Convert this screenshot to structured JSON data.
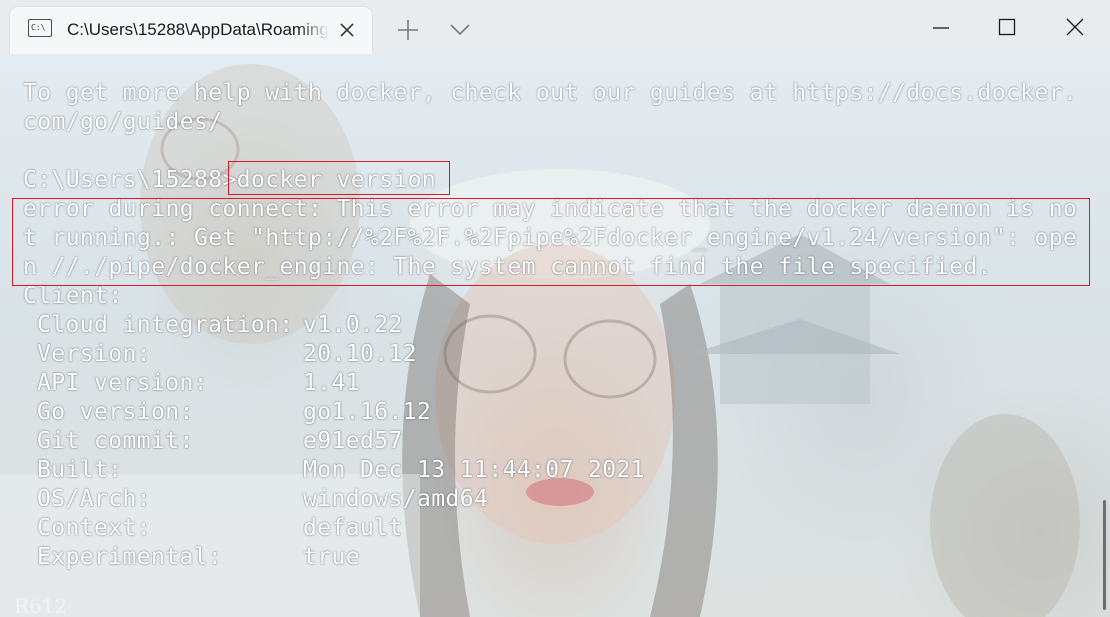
{
  "window": {
    "tab_title": "C:\\Users\\15288\\AppData\\Roaming",
    "tab_icon_glyph": "C:\\",
    "controls": [
      "minimize-icon",
      "maximize-icon",
      "close-icon"
    ],
    "colors": {
      "titlebar": "#e9ecee",
      "tab": "#f6f7f8",
      "highlight": "#d81b2a",
      "terminal_text": "#ffffff"
    }
  },
  "terminal": {
    "help_line_1": "To get more help with docker, check out our guides at https://docs.docker.",
    "help_line_2": "com/go/guides/",
    "prompt": "C:\\Users\\15288>",
    "command": "docker version",
    "error_lines": [
      "error during connect: This error may indicate that the docker daemon is no",
      "t running.: Get \"http://%2F%2F.%2Fpipe%2Fdocker_engine/v1.24/version\": ope",
      "n //./pipe/docker_engine: The system cannot find the file specified."
    ],
    "client_header": "Client:",
    "client": [
      {
        "key": "Cloud integration:",
        "value": "v1.0.22"
      },
      {
        "key": "Version:",
        "value": "20.10.12"
      },
      {
        "key": "API version:",
        "value": "1.41"
      },
      {
        "key": "Go version:",
        "value": "go1.16.12"
      },
      {
        "key": "Git commit:",
        "value": "e91ed57"
      },
      {
        "key": "Built:",
        "value": "Mon Dec 13 11:44:07 2021"
      },
      {
        "key": "OS/Arch:",
        "value": "windows/amd64"
      },
      {
        "key": "Context:",
        "value": "default"
      },
      {
        "key": "Experimental:",
        "value": "true"
      }
    ],
    "watermark": "R612"
  }
}
